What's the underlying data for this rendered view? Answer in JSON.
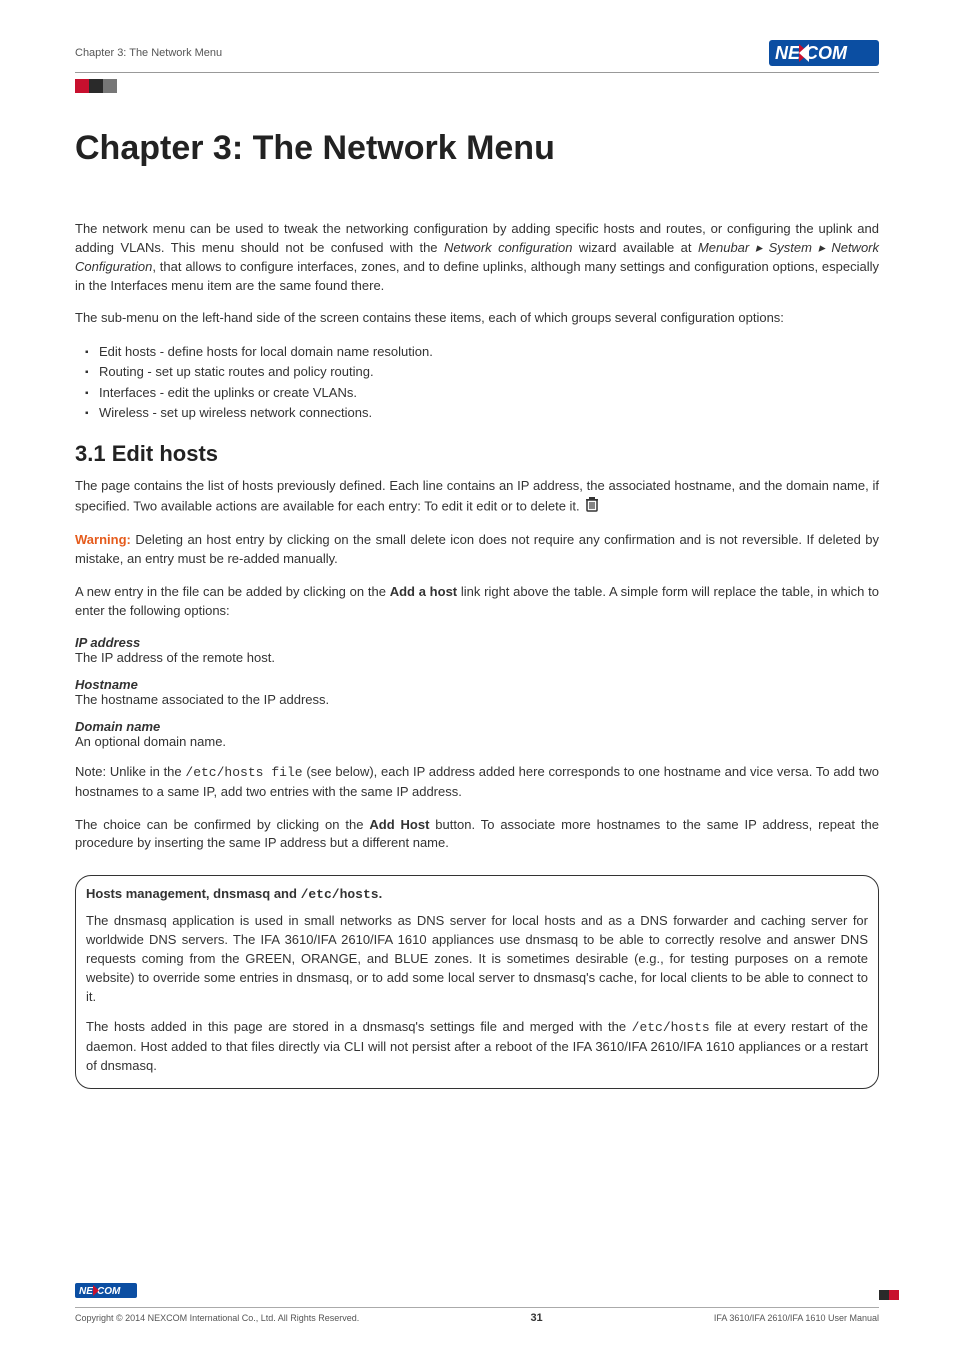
{
  "header": {
    "breadcrumb": "Chapter 3: The Network Menu",
    "brand": "NEXCOM"
  },
  "title": "Chapter 3: The Network Menu",
  "intro1_a": "The network menu can be used to tweak the networking configuration by adding specific hosts and routes, or configuring the uplink and adding VLANs. This menu should not be confused with the ",
  "intro1_netconf": "Network configuration",
  "intro1_b": " wizard available at ",
  "intro1_menubar": "Menubar ▸ System ▸ Network Configuration",
  "intro1_c": ", that allows to configure interfaces, zones, and to define uplinks, although many settings and configuration options, especially in the Interfaces menu item are the same found there.",
  "intro2": "The sub-menu on the left-hand side of the screen contains these items, each of which groups several configuration options:",
  "bullets": [
    "Edit hosts - define hosts for local domain name resolution.",
    "Routing - set up static routes and policy routing.",
    "Interfaces - edit the uplinks or create VLANs.",
    "Wireless - set up wireless network connections."
  ],
  "section_title": "3.1 Edit hosts",
  "section_p1": "The page contains the list of hosts previously defined. Each line contains an IP address, the associated hostname, and the domain name, if specified. Two available actions are available for each entry: To edit it edit or to delete it.",
  "warning_label": "Warning:",
  "warning_text": " Deleting an host entry by clicking on the small delete icon does not require any confirmation and is not reversible. If deleted by mistake, an entry must be re-added manually.",
  "add_host_a": "A new entry in the file can be added by clicking on the ",
  "add_host_bold": "Add a host",
  "add_host_b": " link right above the table. A simple form will replace the table, in which to enter the following options:",
  "fields": {
    "ip_label": "IP address",
    "ip_desc": "The IP address of the remote host.",
    "hostname_label": "Hostname",
    "hostname_desc": "The hostname associated to the IP address.",
    "domain_label": "Domain name",
    "domain_desc": "An optional domain name."
  },
  "note_a": "Note: Unlike in the ",
  "note_mono": "/etc/hosts file",
  "note_b": " (see below), each IP address added here corresponds to one hostname and vice versa. To add two hostnames to a same IP, add two entries with the same IP address.",
  "confirm_a": "The choice can be confirmed by clicking on the ",
  "confirm_bold": "Add Host",
  "confirm_b": " button. To associate more hostnames to the same IP address, repeat the procedure by inserting the same IP address but a different name.",
  "callout": {
    "title_a": "Hosts management, dnsmasq and ",
    "title_mono": "/etc/hosts",
    "title_b": ".",
    "p1": "The dnsmasq application is used in small networks as DNS server for local hosts and as a DNS forwarder and caching server for worldwide DNS servers. The IFA 3610/IFA 2610/IFA 1610 appliances use dnsmasq to be able to correctly resolve and answer DNS requests coming from the GREEN, ORANGE, and BLUE zones. It is sometimes desirable (e.g., for testing purposes on a remote website) to override some entries in dnsmasq, or to add some local server to dnsmasq's cache, for local clients to be able to connect to it.",
    "p2_a": "The hosts added in this page are stored in a dnsmasq's settings file and merged with the ",
    "p2_mono": "/etc/hosts",
    "p2_b": " file at every restart of the daemon. Host added to that files directly via CLI will not persist after a reboot of the IFA 3610/IFA 2610/IFA 1610 appliances or a restart of dnsmasq."
  },
  "footer": {
    "copyright": "Copyright © 2014 NEXCOM International Co., Ltd. All Rights Reserved.",
    "page": "31",
    "doc": "IFA 3610/IFA 2610/IFA 1610 User Manual",
    "brand": "NEXCOM"
  }
}
